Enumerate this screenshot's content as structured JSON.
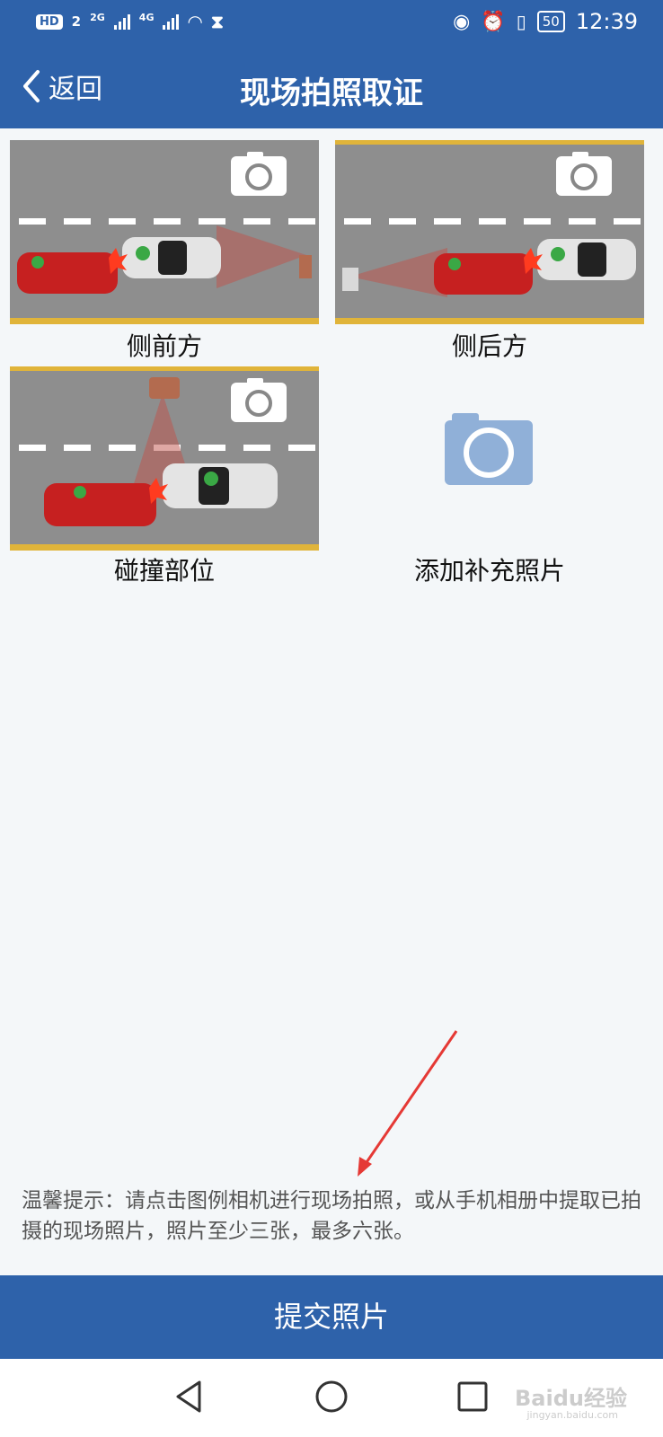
{
  "status_bar": {
    "left": [
      "HD",
      "2",
      "2G",
      "4G"
    ],
    "battery": "50",
    "time": "12:39"
  },
  "header": {
    "back_label": "返回",
    "title": "现场拍照取证"
  },
  "photos": [
    {
      "label": "侧前方"
    },
    {
      "label": "侧后方"
    },
    {
      "label": "碰撞部位"
    },
    {
      "label": "添加补充照片"
    }
  ],
  "tip": "温馨提示：请点击图例相机进行现场拍照，或从手机相册中提取已拍摄的现场照片，照片至少三张，最多六张。",
  "submit_label": "提交照片",
  "watermark": {
    "brand": "Baidu经验",
    "url": "jingyan.baidu.com"
  },
  "colors": {
    "primary": "#2e62aa",
    "road": "#8e8e8e",
    "camera_add": "#90b0d8",
    "arrow": "#e53935"
  }
}
